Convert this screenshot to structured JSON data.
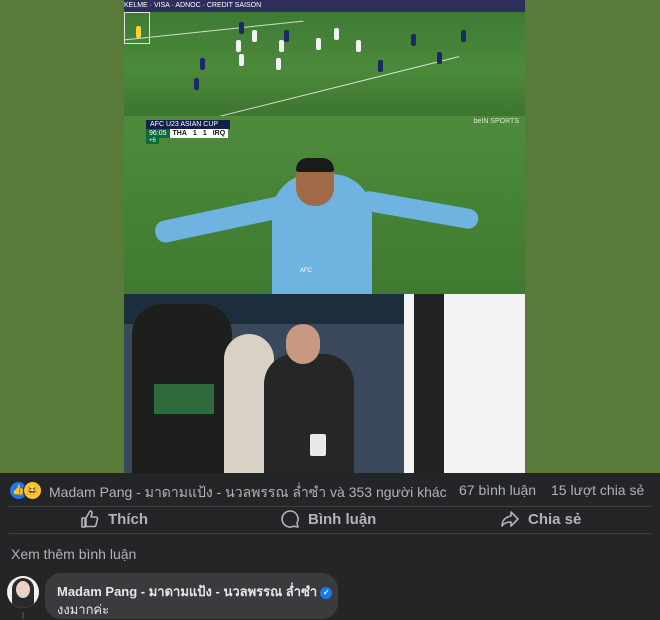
{
  "media": {
    "frame1": {
      "adboard_text": "KELME  ·  VISA  ·  ADNOC  ·  CREDIT SAISON"
    },
    "frame2": {
      "competition": "AFC U23 ASIAN CUP",
      "time": "96:05",
      "home": "THA",
      "home_score": "1",
      "away_score": "1",
      "away": "IRQ",
      "added_time": "+6",
      "watermark": "beIN SPORTS",
      "badge": "AFC"
    }
  },
  "reactions": {
    "like_glyph": "👍",
    "haha_glyph": "😆",
    "names": "Madam Pang - มาดามแป้ง - นวลพรรณ ล่ำซำ và 353 người khác",
    "comments": "67 bình luận",
    "shares": "15 lượt chia sẻ"
  },
  "actions": {
    "like": "Thích",
    "comment": "Bình luận",
    "share": "Chia sẻ"
  },
  "more_comments": "Xem thêm bình luận",
  "comment": {
    "author": "Madam Pang - มาดามแป้ง - นวลพรรณ ล่ำซำ",
    "verified_glyph": "✓",
    "text": "งงมากค่ะ"
  },
  "colors": {
    "background": "#242526",
    "media_bg": "#5a7a3a",
    "text_secondary": "#b0b3b8",
    "accent": "#1877f2"
  }
}
